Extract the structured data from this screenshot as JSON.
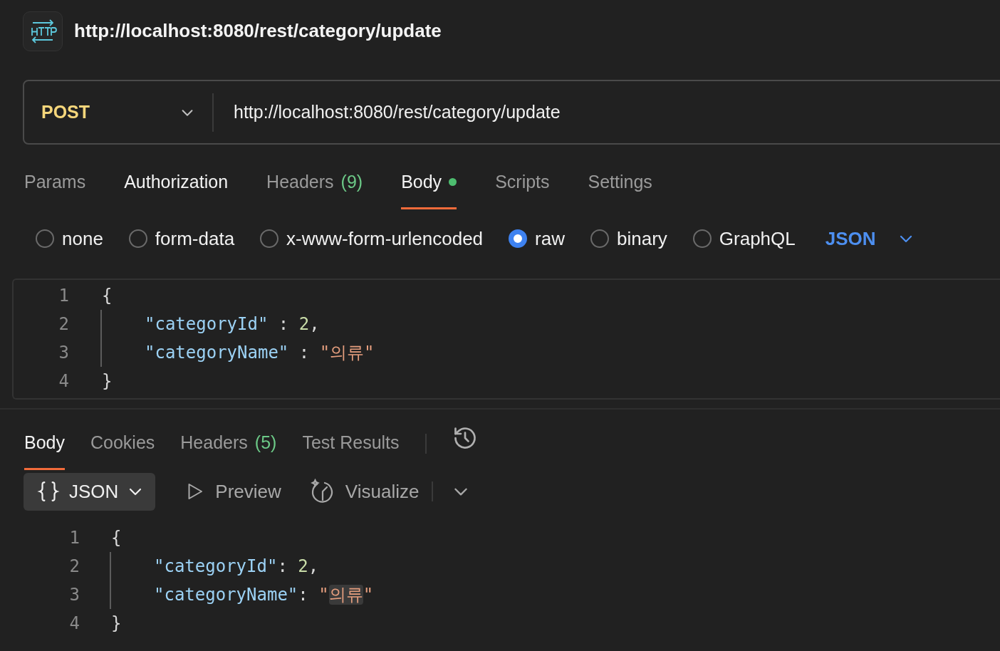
{
  "request": {
    "title": "http://localhost:8080/rest/category/update",
    "method": "POST",
    "url": "http://localhost:8080/rest/category/update"
  },
  "request_tabs": [
    {
      "label": "Params",
      "selected": false,
      "emphasized": false
    },
    {
      "label": "Authorization",
      "selected": false,
      "emphasized": true
    },
    {
      "label": "Headers",
      "count": "(9)",
      "selected": false,
      "emphasized": false
    },
    {
      "label": "Body",
      "dot": true,
      "selected": true,
      "emphasized": true
    },
    {
      "label": "Scripts",
      "selected": false,
      "emphasized": false
    },
    {
      "label": "Settings",
      "selected": false,
      "emphasized": false
    }
  ],
  "body_types": [
    {
      "label": "none",
      "selected": false
    },
    {
      "label": "form-data",
      "selected": false
    },
    {
      "label": "x-www-form-urlencoded",
      "selected": false
    },
    {
      "label": "raw",
      "selected": true
    },
    {
      "label": "binary",
      "selected": false
    },
    {
      "label": "GraphQL",
      "selected": false
    }
  ],
  "body_format": "JSON",
  "request_body": [
    {
      "number": "1",
      "indented": false,
      "tokens": [
        {
          "kind": "punct",
          "text": "{"
        }
      ]
    },
    {
      "number": "2",
      "indented": true,
      "tokens": [
        {
          "kind": "key",
          "text": "\"categoryId\""
        },
        {
          "kind": "punct",
          "text": " : "
        },
        {
          "kind": "number",
          "text": "2"
        },
        {
          "kind": "punct",
          "text": ","
        }
      ]
    },
    {
      "number": "3",
      "indented": true,
      "tokens": [
        {
          "kind": "key",
          "text": "\"categoryName\""
        },
        {
          "kind": "punct",
          "text": " : "
        },
        {
          "kind": "string",
          "text": "\"의류\""
        }
      ]
    },
    {
      "number": "4",
      "indented": false,
      "tokens": [
        {
          "kind": "punct",
          "text": "}"
        }
      ]
    }
  ],
  "response_tabs": [
    {
      "label": "Body",
      "selected": true
    },
    {
      "label": "Cookies",
      "selected": false
    },
    {
      "label": "Headers",
      "count": "(5)",
      "selected": false
    },
    {
      "label": "Test Results",
      "selected": false
    }
  ],
  "response_toolbar": {
    "format": "JSON",
    "actions": [
      "Preview",
      "Visualize"
    ]
  },
  "response_body": [
    {
      "number": "1",
      "indented": false,
      "tokens": [
        {
          "kind": "punct",
          "text": "{"
        }
      ]
    },
    {
      "number": "2",
      "indented": true,
      "tokens": [
        {
          "kind": "key",
          "text": "\"categoryId\""
        },
        {
          "kind": "punct",
          "text": ": "
        },
        {
          "kind": "number",
          "text": "2"
        },
        {
          "kind": "punct",
          "text": ","
        }
      ]
    },
    {
      "number": "3",
      "indented": true,
      "tokens": [
        {
          "kind": "key",
          "text": "\"categoryName\""
        },
        {
          "kind": "punct",
          "text": ": "
        },
        {
          "kind": "string",
          "text": "\""
        },
        {
          "kind": "string",
          "text": "의류",
          "highlighted": true
        },
        {
          "kind": "string",
          "text": "\""
        }
      ]
    },
    {
      "number": "4",
      "indented": false,
      "tokens": [
        {
          "kind": "punct",
          "text": "}"
        }
      ]
    }
  ]
}
